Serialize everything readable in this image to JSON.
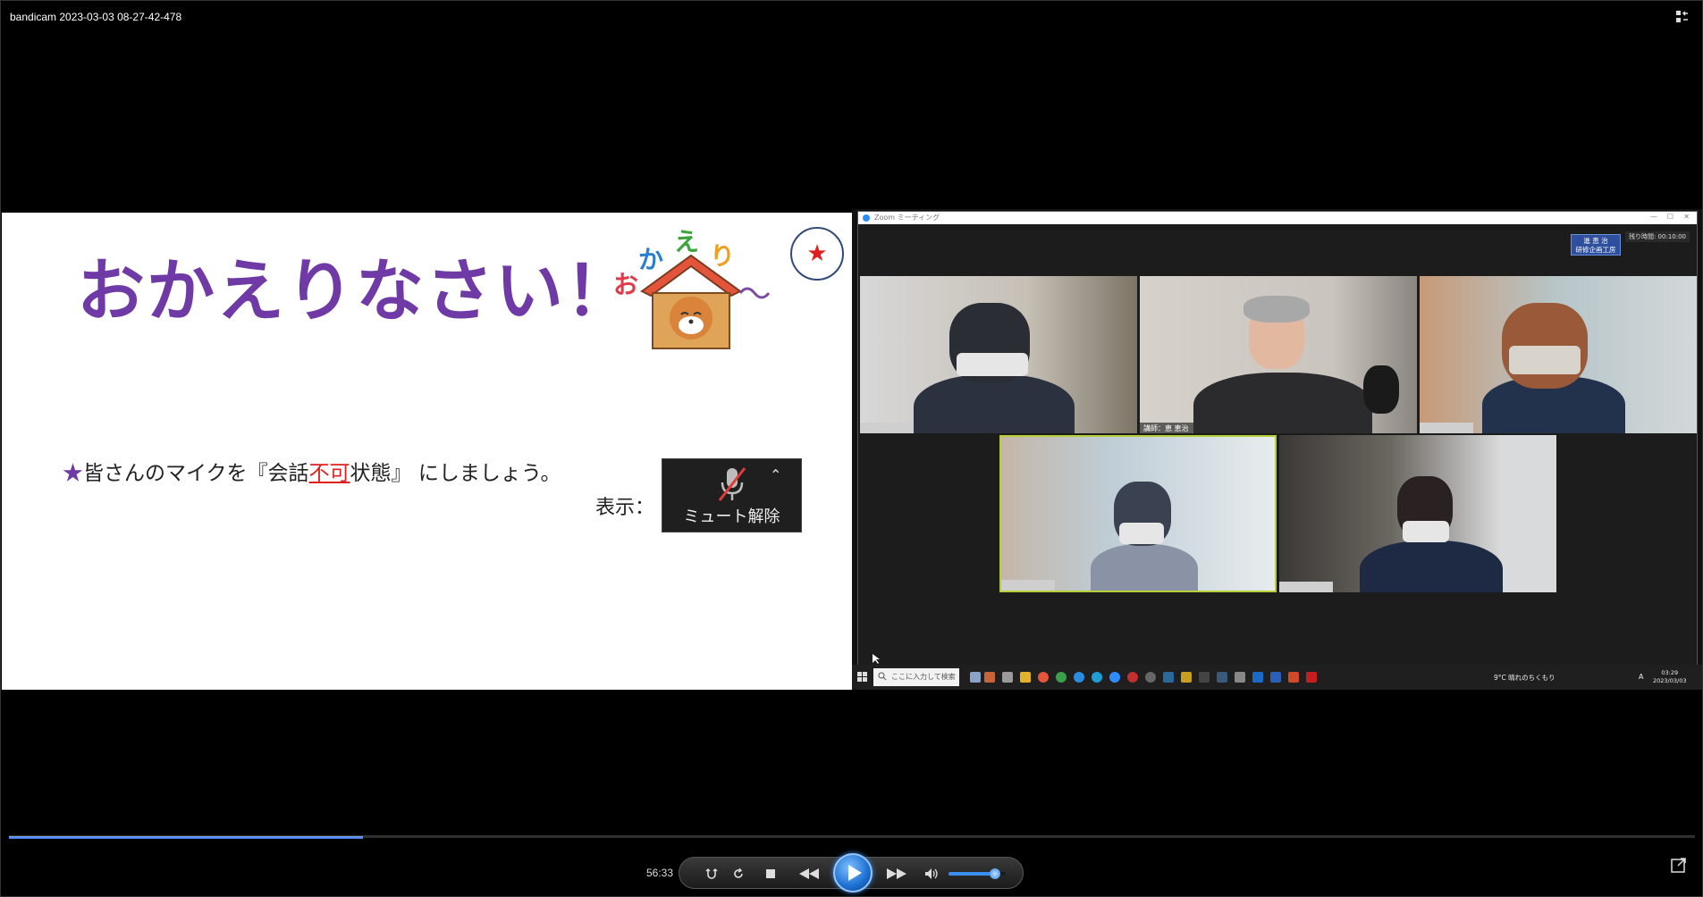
{
  "window": {
    "title": "bandicam 2023-03-03 08-27-42-478"
  },
  "slide": {
    "title": "おかえりなさい！",
    "logo_text": "おかえり〜",
    "star_symbol": "★",
    "instruction": {
      "star": "★",
      "before": "皆さんのマイクを『会話",
      "emphasis": "不可",
      "after": "状態』 にしましょう。"
    },
    "display_label": "表示：",
    "mute_button_label": "ミュート解除"
  },
  "zoom": {
    "window_title": "Zoom ミーティング",
    "timer": "残り時間: 00:10:00",
    "host_badge_line1": "進 恵 治",
    "host_badge_line2": "研修企画工房",
    "participants": [
      {
        "name": "",
        "blurred": true
      },
      {
        "name": "講師：恵 恵治",
        "blurred": false
      },
      {
        "name": "",
        "blurred": true
      },
      {
        "name": "",
        "blurred": true,
        "active_speaker": true
      },
      {
        "name": "",
        "blurred": true
      }
    ]
  },
  "taskbar": {
    "search_placeholder": "ここに入力して検索",
    "weather": "9°C 晴れのちくもり",
    "ime": "A",
    "time": "03:29",
    "date": "2023/03/03"
  },
  "player": {
    "elapsed": "56:33",
    "progress_fraction": 0.21,
    "volume_fraction": 0.82,
    "accent_color": "#2f7fe0"
  }
}
